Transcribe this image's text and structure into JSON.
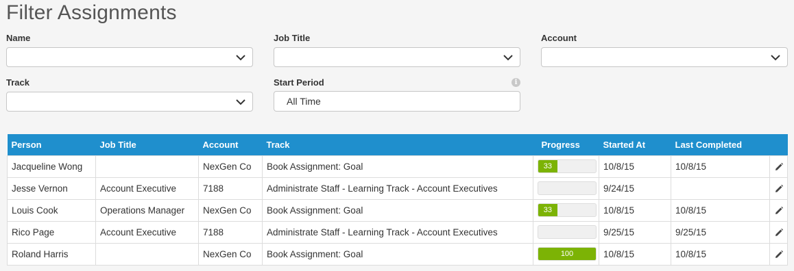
{
  "page": {
    "title": "Filter Assignments"
  },
  "filters": {
    "name_label": "Name",
    "job_title_label": "Job Title",
    "account_label": "Account",
    "track_label": "Track",
    "start_period_label": "Start Period",
    "start_period_value": "All Time"
  },
  "table": {
    "headers": {
      "person": "Person",
      "job_title": "Job Title",
      "account": "Account",
      "track": "Track",
      "progress": "Progress",
      "started_at": "Started At",
      "last_completed": "Last Completed"
    },
    "rows": [
      {
        "person": "Jacqueline Wong",
        "job_title": "",
        "account": "NexGen Co",
        "track": "Book Assignment: Goal",
        "progress": 33,
        "progress_label": "33",
        "started_at": "10/8/15",
        "last_completed": "10/8/15"
      },
      {
        "person": "Jesse Vernon",
        "job_title": "Account Executive",
        "account": "7188",
        "track": "Administrate Staff - Learning Track - Account Executives",
        "progress": 0,
        "progress_label": "",
        "started_at": "9/24/15",
        "last_completed": ""
      },
      {
        "person": "Louis Cook",
        "job_title": "Operations Manager",
        "account": "NexGen Co",
        "track": "Book Assignment: Goal",
        "progress": 33,
        "progress_label": "33",
        "started_at": "10/8/15",
        "last_completed": "10/8/15"
      },
      {
        "person": "Rico Page",
        "job_title": "Account Executive",
        "account": "7188",
        "track": "Administrate Staff - Learning Track - Account Executives",
        "progress": 0,
        "progress_label": "",
        "started_at": "9/25/15",
        "last_completed": "9/25/15"
      },
      {
        "person": "Roland Harris",
        "job_title": "",
        "account": "NexGen Co",
        "track": "Book Assignment: Goal",
        "progress": 100,
        "progress_label": "100",
        "started_at": "10/8/15",
        "last_completed": "10/8/15"
      }
    ]
  },
  "colors": {
    "header_bg": "#1f8fcd",
    "progress_fill": "#7cb305"
  },
  "icons": {
    "dropdown": "chevron-down-icon",
    "info": "info-icon",
    "edit": "pencil-icon"
  }
}
